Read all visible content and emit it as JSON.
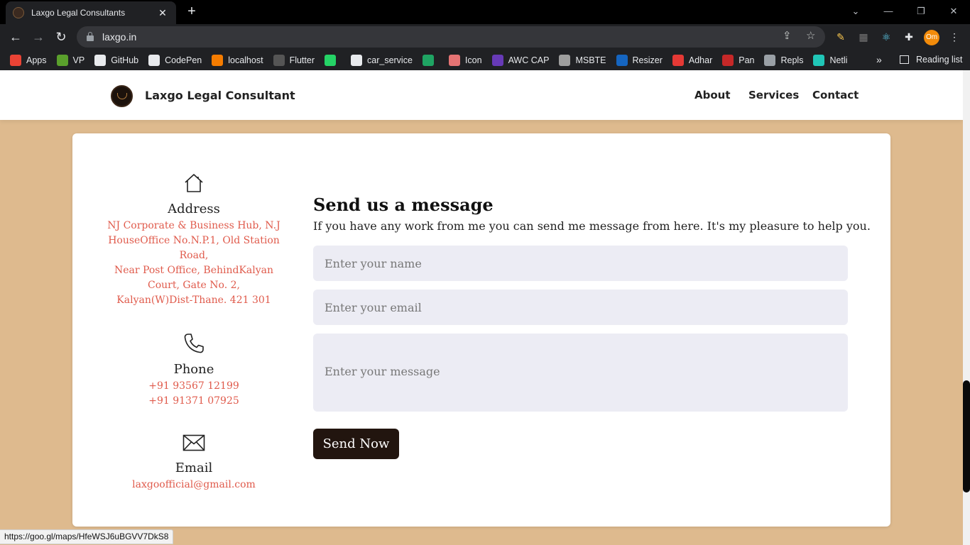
{
  "browser": {
    "tab_title": "Laxgo Legal Consultants",
    "tab_close": "✕",
    "new_tab": "+",
    "url": "laxgo.in",
    "profile_initials": "Om",
    "window_controls": [
      "⌄",
      "—",
      "❐",
      "✕"
    ],
    "bookmarks": [
      {
        "label": "Apps",
        "icon": "apps-grid-icon",
        "color": "#ea4335"
      },
      {
        "label": "VP",
        "icon": "vp-icon",
        "color": "#5aa02c"
      },
      {
        "label": "GitHub",
        "icon": "github-icon",
        "color": "#e8eaed"
      },
      {
        "label": "CodePen",
        "icon": "codepen-icon",
        "color": "#e8eaed"
      },
      {
        "label": "localhost",
        "icon": "xampp-icon",
        "color": "#f57c00"
      },
      {
        "label": "Flutter",
        "icon": "github-icon",
        "color": "#555"
      },
      {
        "label": "",
        "icon": "whatsapp-icon",
        "color": "#25d366"
      },
      {
        "label": "car_service",
        "icon": "github-icon",
        "color": "#e8eaed"
      },
      {
        "label": "",
        "icon": "sheets-icon",
        "color": "#1fa463"
      },
      {
        "label": "Icon",
        "icon": "icon-grid-icon",
        "color": "#e57373"
      },
      {
        "label": "AWC CAP",
        "icon": "list-icon",
        "color": "#673ab7"
      },
      {
        "label": "MSBTE",
        "icon": "msbte-icon",
        "color": "#9e9e9e"
      },
      {
        "label": "Resizer",
        "icon": "pdf-icon",
        "color": "#1565c0"
      },
      {
        "label": "Adhar",
        "icon": "aadhaar-icon",
        "color": "#e53935"
      },
      {
        "label": "Pan",
        "icon": "nsdl-icon",
        "color": "#c62828"
      },
      {
        "label": "Repls",
        "icon": "replit-icon",
        "color": "#9aa0a6"
      },
      {
        "label": "Netli",
        "icon": "netlify-icon",
        "color": "#20c6b7"
      }
    ],
    "bookmarks_overflow": "»",
    "reading_list": "Reading list",
    "status_url": "https://goo.gl/maps/HfeWSJ6uBGVV7DkS8"
  },
  "site": {
    "brand": "Laxgo Legal Consultant",
    "nav": [
      "About",
      "Services",
      "Contact"
    ]
  },
  "contact": {
    "address": {
      "title": "Address",
      "lines": [
        "NJ Corporate & Business Hub, N.J",
        "HouseOffice No.N.P.1, Old Station",
        "Road,",
        "Near Post Office, BehindKalyan",
        "Court, Gate No. 2,",
        "Kalyan(W)Dist-Thane. 421 301"
      ]
    },
    "phone": {
      "title": "Phone",
      "lines": [
        "+91 93567 12199",
        "+91 91371 07925"
      ]
    },
    "email": {
      "title": "Email",
      "value": "laxgoofficial@gmail.com"
    }
  },
  "form": {
    "heading": "Send us a message",
    "subtext": "If you have any work from me you can send me message from here. It's my pleasure to help you.",
    "name_placeholder": "Enter your name",
    "email_placeholder": "Enter your email",
    "message_placeholder": "Enter your message",
    "button": "Send Now"
  },
  "colors": {
    "page_bg": "#deba8e",
    "accent_link": "#e05b4c",
    "button_bg": "#22150f"
  }
}
